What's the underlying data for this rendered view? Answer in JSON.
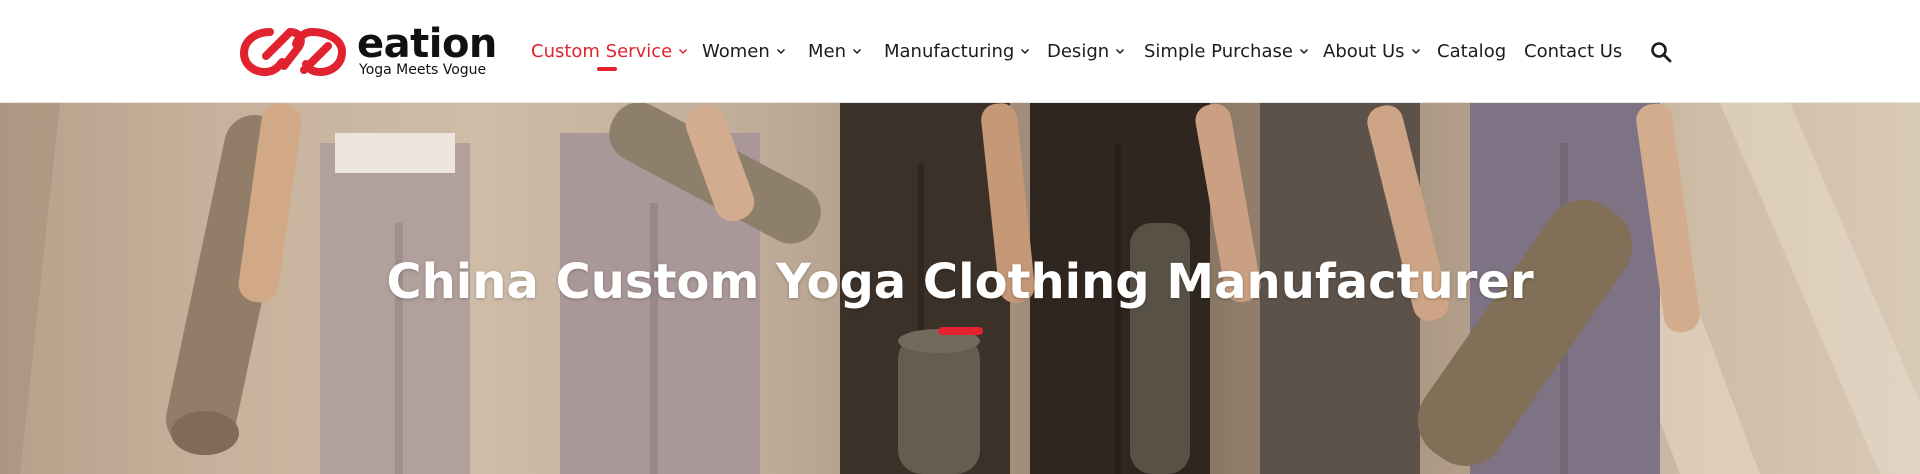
{
  "brand": {
    "name": "eation",
    "tagline": "Yoga Meets Vogue",
    "accent_color": "#e0232f"
  },
  "nav": {
    "items": [
      {
        "label": "Custom Service",
        "has_dropdown": true,
        "active": true
      },
      {
        "label": "Women",
        "has_dropdown": true,
        "active": false
      },
      {
        "label": "Men",
        "has_dropdown": true,
        "active": false
      },
      {
        "label": "Manufacturing",
        "has_dropdown": true,
        "active": false
      },
      {
        "label": "Design",
        "has_dropdown": true,
        "active": false
      },
      {
        "label": "Simple Purchase",
        "has_dropdown": true,
        "active": false
      },
      {
        "label": "About Us",
        "has_dropdown": true,
        "active": false
      },
      {
        "label": "Catalog",
        "has_dropdown": false,
        "active": false
      },
      {
        "label": "Contact Us",
        "has_dropdown": false,
        "active": false
      }
    ],
    "search_icon": "search-icon"
  },
  "hero": {
    "title": "China Custom Yoga Clothing Manufacturer"
  }
}
